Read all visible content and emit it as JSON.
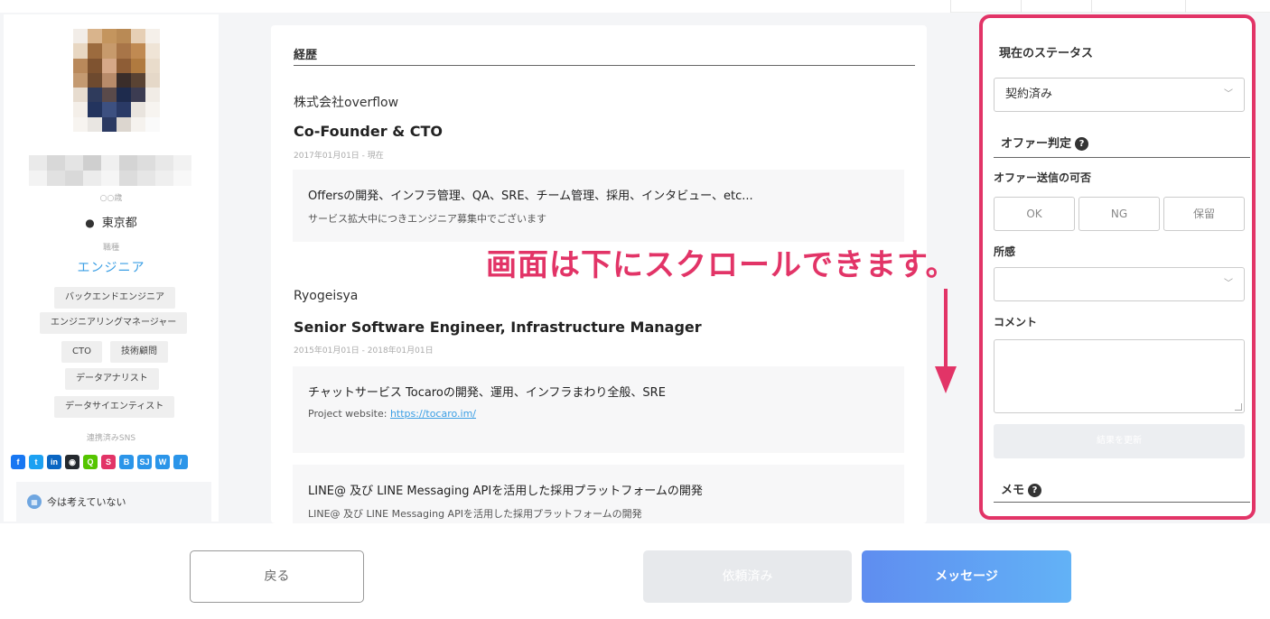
{
  "profile": {
    "name_hidden_caption": "○○歳",
    "location": "東京都",
    "job_caption": "職種",
    "job_title": "エンジニア",
    "tags": [
      "バックエンドエンジニア",
      "エンジニアリングマネージャー",
      "CTO",
      "技術顧問",
      "データアナリスト",
      "データサイエンティスト"
    ],
    "sns_caption": "連携済みSNS",
    "sns_icons": [
      {
        "name": "facebook-icon",
        "glyph": "f",
        "color": "#1877f2"
      },
      {
        "name": "twitter-icon",
        "glyph": "t",
        "color": "#1da1f2"
      },
      {
        "name": "linkedin-icon",
        "glyph": "in",
        "color": "#0a66c2"
      },
      {
        "name": "github-icon",
        "glyph": "◉",
        "color": "#24292e"
      },
      {
        "name": "qiita-icon",
        "glyph": "Q",
        "color": "#55c500"
      },
      {
        "name": "speakerdeck-icon",
        "glyph": "S",
        "color": "#e23467"
      },
      {
        "name": "hatena-icon",
        "glyph": "B",
        "color": "#2b95e9"
      },
      {
        "name": "sj-icon",
        "glyph": "SJ",
        "color": "#2b95e9"
      },
      {
        "name": "wantedly-icon",
        "glyph": "W",
        "color": "#2b95e9"
      },
      {
        "name": "other-icon",
        "glyph": "/",
        "color": "#2b95e9"
      }
    ],
    "job_change_status": "今は考えていない",
    "job_change_icon": "calendar-icon"
  },
  "career": {
    "header": "経歴",
    "entries": [
      {
        "company": "株式会社overflow",
        "position": "Co-Founder & CTO",
        "period": "2017年01月01日 - 現在",
        "projects": [
          {
            "title": "Offersの開発、インフラ管理、QA、SRE、チーム管理、採用、インタビュー、etc...",
            "desc": "サービス拡大中につきエンジニア募集中でございます",
            "link_label": "",
            "link": ""
          }
        ]
      },
      {
        "company": "Ryogeisya",
        "position": "Senior Software Engineer, Infrastructure Manager",
        "period": "2015年01月01日 - 2018年01月01日",
        "projects": [
          {
            "title": "チャットサービス Tocaroの開発、運用、インフラまわり全般、SRE",
            "desc": "Project website: ",
            "link": "https://tocaro.im/"
          },
          {
            "title": "LINE@ 及び LINE Messaging APIを活用した採用プラットフォームの開発",
            "desc": "LINE@ 及び LINE Messaging APIを活用した採用プラットフォームの開発",
            "link": ""
          }
        ]
      }
    ]
  },
  "panel": {
    "status_header": "現在のステータス",
    "status_value": "契約済み",
    "offer_header": "オファー判定",
    "offer_send_label": "オファー送信の可否",
    "offer_options": [
      "OK",
      "NG",
      "保留"
    ],
    "impression_label": "所感",
    "impression_value": "",
    "comment_label": "コメント",
    "update_button": "結果を更新",
    "memo_header": "メモ",
    "accent_color": "#e23467"
  },
  "annotation": {
    "text": "画面は下にスクロールできます。"
  },
  "footer": {
    "back_label": "戻る",
    "requested_label": "依頼済み",
    "message_label": "メッセージ"
  }
}
